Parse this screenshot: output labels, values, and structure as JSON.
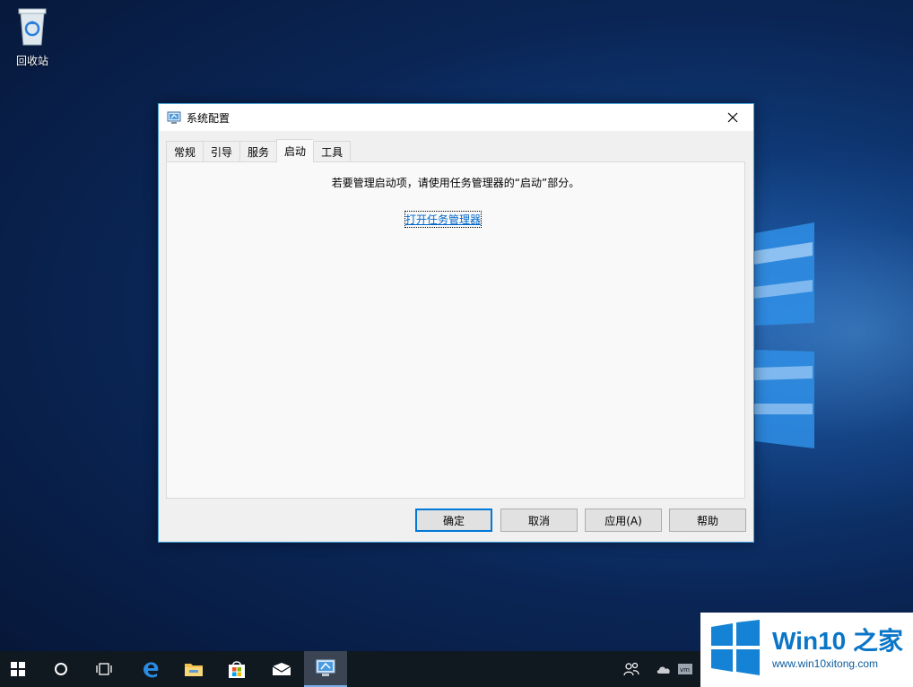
{
  "desktop": {
    "recycle_bin_label": "回收站"
  },
  "dialog": {
    "title": "系统配置",
    "tabs": [
      {
        "label": "常规"
      },
      {
        "label": "引导"
      },
      {
        "label": "服务"
      },
      {
        "label": "启动",
        "active": true
      },
      {
        "label": "工具"
      }
    ],
    "message": "若要管理启动项，请使用任务管理器的“启动”部分。",
    "link": "打开任务管理器",
    "buttons": {
      "ok": "确定",
      "cancel": "取消",
      "apply": "应用(A)",
      "help": "帮助"
    }
  },
  "taskbar": {
    "items": [
      "start-icon",
      "cortana-icon",
      "task-view-icon",
      "edge-icon",
      "file-explorer-icon",
      "store-icon",
      "mail-icon",
      "msconfig-icon"
    ],
    "tray": [
      "people-icon",
      "onedrive-icon",
      "vmware-icon"
    ]
  },
  "watermark": {
    "brand": "Win10 之家",
    "url": "www.win10xitong.com"
  },
  "colors": {
    "accent": "#0078d7",
    "link": "#0066cc",
    "taskbar": "#101820",
    "watermark_blue": "#0b76c8"
  }
}
